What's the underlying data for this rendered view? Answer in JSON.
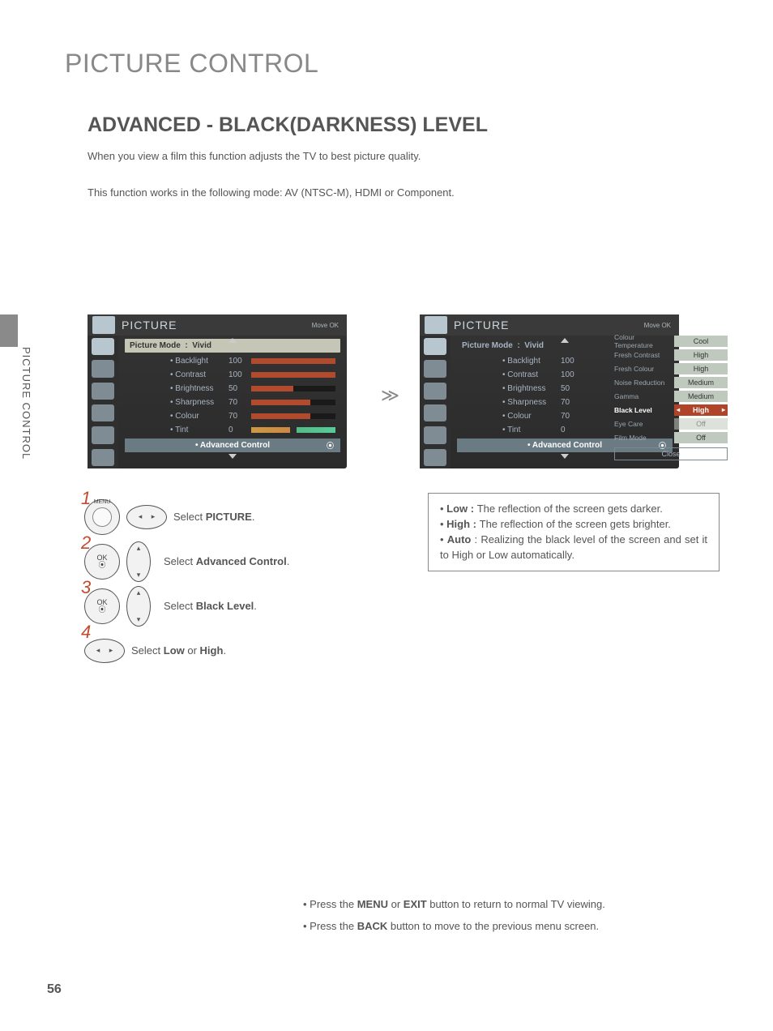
{
  "page_title": "PICTURE CONTROL",
  "section_title": "ADVANCED - BLACK(DARKNESS) LEVEL",
  "intro_line1": "When you view a film this function adjusts the TV to best picture quality.",
  "intro_line2": "This function works in the following mode: AV (NTSC-M), HDMI or Component.",
  "side_label": "PICTURE CONTROL",
  "osd": {
    "title": "PICTURE",
    "hint": "Move    OK",
    "mode_label": "Picture Mode",
    "mode_value": "Vivid",
    "items": [
      {
        "label": "• Backlight",
        "value": "100",
        "pct": 100
      },
      {
        "label": "• Contrast",
        "value": "100",
        "pct": 100
      },
      {
        "label": "• Brightness",
        "value": "50",
        "pct": 50
      },
      {
        "label": "• Sharpness",
        "value": "70",
        "pct": 70
      },
      {
        "label": "• Colour",
        "value": "70",
        "pct": 70
      },
      {
        "label": "• Tint",
        "value": "0",
        "pct": 0
      }
    ],
    "advanced": "• Advanced Control"
  },
  "popup": [
    {
      "label": "Colour Temperature",
      "value": "Cool"
    },
    {
      "label": "Fresh Contrast",
      "value": "High"
    },
    {
      "label": "Fresh Colour",
      "value": "High"
    },
    {
      "label": "Noise Reduction",
      "value": "Medium"
    },
    {
      "label": "Gamma",
      "value": "Medium"
    },
    {
      "label": "Black Level",
      "value": "High",
      "selected": true
    },
    {
      "label": "Eye Care",
      "value": "Off",
      "disabled": true
    },
    {
      "label": "Film Mode",
      "value": "Off"
    }
  ],
  "popup_close": "Close",
  "steps": {
    "menu_label": "MENU",
    "ok_label": "OK",
    "s1": "Select PICTURE.",
    "s2": "Select Advanced Control.",
    "s3": "Select Black Level.",
    "s4": "Select Low or High."
  },
  "explain": {
    "low_label": "Low",
    "low_sep": " : ",
    "low_text": "The reflection of the screen gets darker.",
    "high_label": "High",
    "high_sep": " : ",
    "high_text": "The reflection of the screen gets brighter.",
    "auto_label": "Auto",
    "auto_sep": " : ",
    "auto_text": "Realizing the black level of the screen and set it to High or Low automatically."
  },
  "footer": {
    "line1_a": "• Press the ",
    "line1_b": "MENU",
    "line1_c": " or ",
    "line1_d": "EXIT",
    "line1_e": " button to return to normal TV viewing.",
    "line2_a": "• Press the ",
    "line2_b": "BACK",
    "line2_c": " button to move to the previous menu screen."
  },
  "page_number": "56"
}
